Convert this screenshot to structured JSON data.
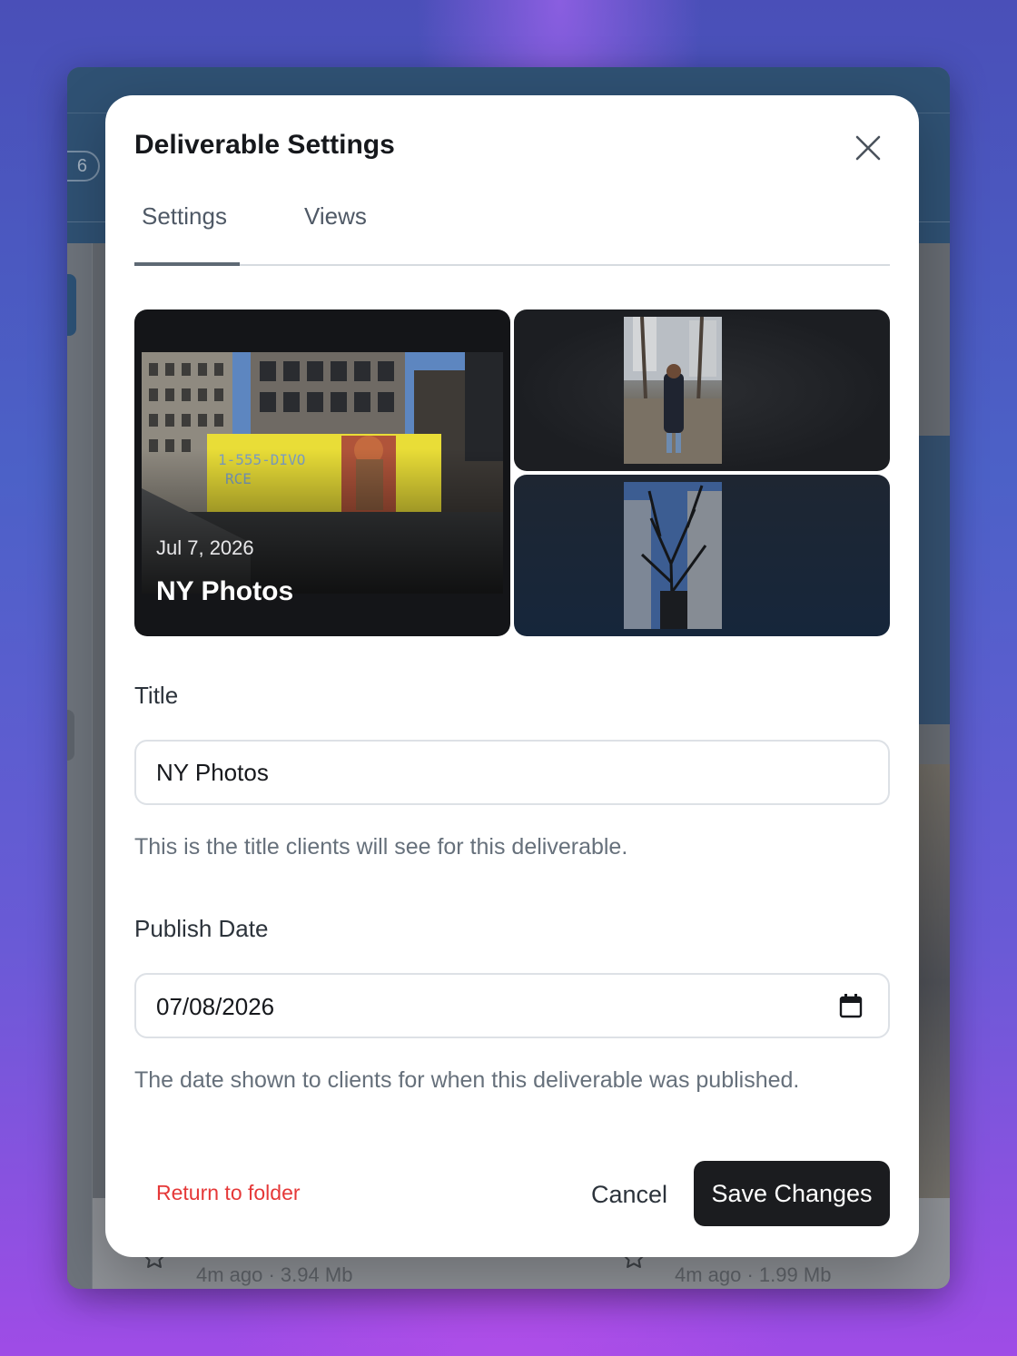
{
  "background": {
    "count_badge": "6",
    "files": [
      {
        "meta": "4m ago · 3.94 Mb"
      },
      {
        "meta": "4m ago · 1.99 Mb"
      }
    ]
  },
  "modal": {
    "title": "Deliverable Settings",
    "close_icon": "close-icon",
    "tabs": [
      {
        "label": "Settings",
        "active": true
      },
      {
        "label": "Views",
        "active": false
      }
    ],
    "preview": {
      "date": "Jul 7, 2026",
      "title": "NY Photos",
      "billboard_text": "1-555-DIVO RCE"
    },
    "title_field": {
      "label": "Title",
      "value": "NY Photos",
      "help": "This is the title clients will see for this deliverable."
    },
    "date_field": {
      "label": "Publish Date",
      "value": "07/08/2026",
      "icon": "calendar-icon",
      "help": "The date shown to clients for when this deliverable was published."
    },
    "footer": {
      "return_link": "Return to folder",
      "cancel_label": "Cancel",
      "save_label": "Save Changes"
    }
  },
  "colors": {
    "danger": "#e53838",
    "primary_button": "#1b1c1f",
    "tab_indicator": "#5e6974"
  }
}
